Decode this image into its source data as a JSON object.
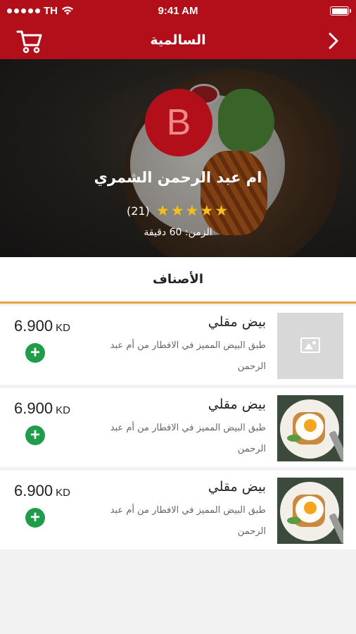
{
  "status_bar": {
    "carrier": "TH",
    "time": "9:41 AM"
  },
  "nav": {
    "title": "السالمية"
  },
  "chef": {
    "avatar_letter": "B",
    "name": "ام عبد الرحمن الشمري",
    "rating_stars": 5,
    "stars_text": "★★★★★",
    "reviews": "(21)",
    "prep_time": "الزمن: 60 دقيقة"
  },
  "section": {
    "label": "الأصناف"
  },
  "items": [
    {
      "name": "بيض مقلي",
      "description": "طبق البيض المميز في الافطار من أم عبد الرحمن",
      "price": "6.900",
      "currency": "KD",
      "add_label": "+",
      "image": "placeholder-image-icon"
    },
    {
      "name": "بيض مقلي",
      "description": "طبق البيض المميز في الافطار من أم عبد الرحمن",
      "price": "6.900",
      "currency": "KD",
      "add_label": "+",
      "image": "fried-egg-photo"
    },
    {
      "name": "بيض مقلي",
      "description": "طبق البيض المميز في الافطار من أم عبد الرحمن",
      "price": "6.900",
      "currency": "KD",
      "add_label": "+",
      "image": "fried-egg-photo"
    }
  ],
  "colors": {
    "brand": "#b20f1b",
    "accent": "#e8a34a",
    "add": "#1f9d4a",
    "star": "#f6bf1b"
  }
}
